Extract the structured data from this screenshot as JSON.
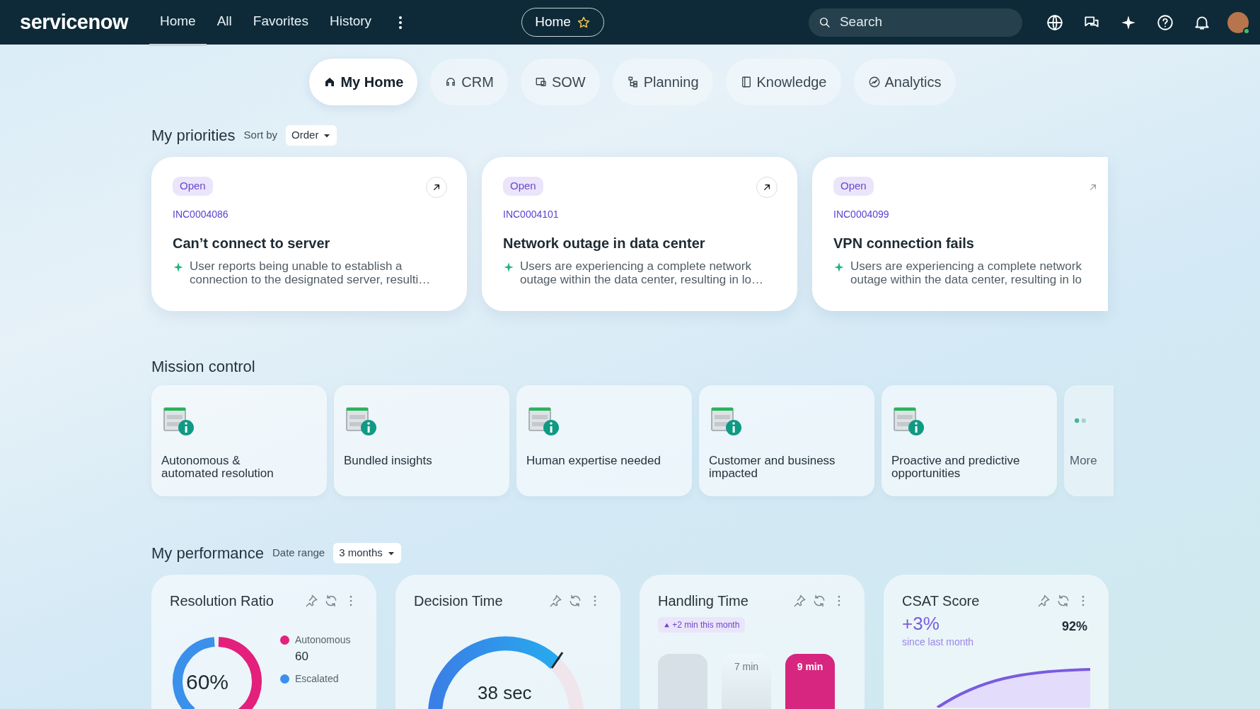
{
  "navbar": {
    "logo": "servicenow",
    "items": [
      {
        "label": "Home",
        "selected": true
      },
      {
        "label": "All",
        "selected": false
      },
      {
        "label": "Favorites",
        "selected": false
      },
      {
        "label": "History",
        "selected": false
      }
    ],
    "pill": {
      "label": "Home"
    },
    "search": {
      "placeholder": "Search"
    }
  },
  "tabs": [
    {
      "label": "My Home",
      "selected": true
    },
    {
      "label": "CRM",
      "selected": false
    },
    {
      "label": "SOW",
      "selected": false
    },
    {
      "label": "Planning",
      "selected": false
    },
    {
      "label": "Knowledge",
      "selected": false
    },
    {
      "label": "Analytics",
      "selected": false
    }
  ],
  "priorities": {
    "title": "My priorities",
    "sort_label": "Sort by",
    "sort_value": "Order",
    "cards": [
      {
        "status": "Open",
        "number": "INC0004086",
        "title": "Can’t connect to server",
        "summary": "User reports being unable to establish a connection to the designated server, resulti…"
      },
      {
        "status": "Open",
        "number": "INC0004101",
        "title": "Network outage in data center",
        "summary": "Users are experiencing a complete network outage within the data center, resulting in lo…"
      },
      {
        "status": "Open",
        "number": "INC0004099",
        "title": "VPN connection fails",
        "summary": "Users are experiencing a complete network outage within the data center, resulting in lo"
      }
    ]
  },
  "mission": {
    "title": "Mission control",
    "tiles": [
      {
        "kind": "tile",
        "label": "Autonomous & automated resolution"
      },
      {
        "kind": "tile",
        "label": "Bundled insights"
      },
      {
        "kind": "tile",
        "label": "Human expertise needed"
      },
      {
        "kind": "tile",
        "label": "Customer and business impacted"
      },
      {
        "kind": "tile",
        "label": "Proactive and predictive opportunities"
      },
      {
        "kind": "more",
        "label": "More"
      }
    ]
  },
  "performance": {
    "title": "My performance",
    "range_label": "Date range",
    "range_value": "3 months",
    "cards": [
      {
        "kind": "ratio",
        "title": "Resolution Ratio",
        "value": "60%",
        "legend": [
          {
            "label": "Autonomous",
            "value": "60",
            "color": "#e3207c"
          },
          {
            "label": "Escalated",
            "color": "#3a90ea"
          }
        ]
      },
      {
        "kind": "gauge",
        "title": "Decision Time",
        "value": "38 sec"
      },
      {
        "kind": "bars",
        "title": "Handling Time",
        "trend": "+2 min this month",
        "bars": [
          {
            "highlight": false
          },
          {
            "label": "7 min",
            "highlight": false
          },
          {
            "label": "9 min",
            "highlight": true
          }
        ]
      },
      {
        "kind": "score",
        "title": "CSAT Score",
        "change": "+3%",
        "change_note": "since last month",
        "value": "92%"
      }
    ]
  }
}
